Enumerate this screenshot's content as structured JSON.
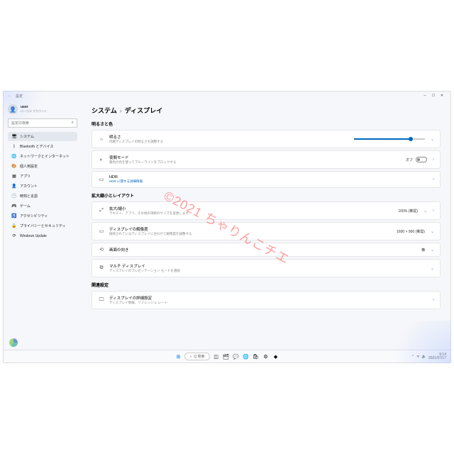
{
  "window": {
    "title": "設定"
  },
  "user": {
    "name": "user",
    "account": "ローカル アカウント"
  },
  "search": {
    "placeholder": "設定の検索"
  },
  "sidebar": {
    "items": [
      {
        "icon": "🖥",
        "label": "システム",
        "active": true
      },
      {
        "icon": "ᛒ",
        "label": "Bluetooth とデバイス"
      },
      {
        "icon": "🌐",
        "label": "ネットワークとインターネット"
      },
      {
        "icon": "🎨",
        "label": "個人用設定"
      },
      {
        "icon": "▦",
        "label": "アプリ"
      },
      {
        "icon": "👤",
        "label": "アカウント"
      },
      {
        "icon": "🕒",
        "label": "時刻と言語"
      },
      {
        "icon": "🎮",
        "label": "ゲーム"
      },
      {
        "icon": "♿",
        "label": "アクセシビリティ"
      },
      {
        "icon": "🔒",
        "label": "プライバシーとセキュリティ"
      },
      {
        "icon": "⟳",
        "label": "Windows Update"
      }
    ]
  },
  "breadcrumb": {
    "a": "システム",
    "b": "ディスプレイ"
  },
  "sections": {
    "brightness": {
      "title": "明るさと色",
      "items": {
        "brightness": {
          "title": "明るさ",
          "desc": "内蔵ディスプレイの明るさを調整する",
          "value_pct": 80
        },
        "nightlight": {
          "title": "夜間モード",
          "desc": "暖色の色を使ってブルーライトをブロックする",
          "state": "オフ"
        },
        "hdr": {
          "title": "HDR",
          "desc": "HDR に関する詳細情報"
        }
      }
    },
    "scale": {
      "title": "拡大縮小とレイアウト",
      "items": {
        "scale": {
          "title": "拡大/縮小",
          "desc": "テキスト、アプリ、その他の項目のサイズを変更します",
          "value": "100% (推奨)"
        },
        "resolution": {
          "title": "ディスプレイの解像度",
          "desc": "接続されているディスプレイに合わせて解像度を調整する",
          "value": "1600 × 900 (推奨)"
        },
        "orientation": {
          "title": "画面の向き",
          "value": "横"
        },
        "multi": {
          "title": "マルチ ディスプレイ",
          "desc": "ディスプレイのプレゼンテーション モードを選択"
        }
      }
    },
    "related": {
      "title": "関連設定",
      "items": {
        "advanced": {
          "title": "ディスプレイの詳細設定",
          "desc": "ディスプレイ情報、リフレッシュ レート"
        }
      }
    }
  },
  "taskbar": {
    "search": "Q 検索",
    "icons": [
      "start",
      "search",
      "taskview",
      "files",
      "chat",
      "edge",
      "store",
      "settings",
      "app"
    ]
  },
  "tray": {
    "time": "9:14",
    "date": "2021/07/17"
  },
  "watermark": "©2021 ちゃりんこチエ"
}
